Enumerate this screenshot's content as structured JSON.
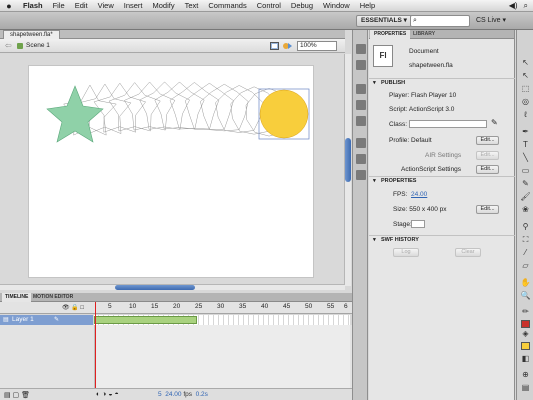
{
  "menubar": {
    "app": "Flash",
    "items": [
      "File",
      "Edit",
      "View",
      "Insert",
      "Modify",
      "Text",
      "Commands",
      "Control",
      "Debug",
      "Window",
      "Help"
    ]
  },
  "appbar": {
    "workspace": "ESSENTIALS ▾",
    "search_placeholder": "",
    "cslive": "CS Live ▾"
  },
  "document": {
    "tab": "shapetween.fla*",
    "scene": "Scene 1",
    "zoom": "100%"
  },
  "stage": {
    "colors": {
      "star_fill": "#8fd1a8",
      "circle_fill": "#f8ce3c",
      "onion_stroke": "#9a9a9a"
    }
  },
  "timeline": {
    "tabs": [
      "TIMELINE",
      "MOTION EDITOR"
    ],
    "layer": "Layer 1",
    "ruler": [
      "5",
      "10",
      "15",
      "20",
      "25",
      "30",
      "35",
      "40",
      "45",
      "50",
      "55",
      "6"
    ],
    "fps_value": "24.00",
    "fps_unit": "fps",
    "time": "0.2s",
    "frame": "5"
  },
  "properties": {
    "tabs": [
      "PROPERTIES",
      "LIBRARY"
    ],
    "doc_icon": "Fl",
    "doc_type": "Document",
    "doc_name": "shapetween.fla",
    "publish_header": "PUBLISH",
    "player": "Player: Flash Player 10",
    "script": "Script: ActionScript 3.0",
    "class_label": "Class:",
    "profile": "Profile: Default",
    "edit_label": "Edit...",
    "air_settings": "AIR Settings",
    "actionscript_settings": "ActionScript Settings",
    "properties_header": "PROPERTIES",
    "fps_label": "FPS:",
    "fps_value": "24.00",
    "size": "Size: 550 x 400 px",
    "stage_label": "Stage:",
    "swf_header": "SWF HISTORY",
    "log": "Log",
    "clear": "Clear"
  }
}
